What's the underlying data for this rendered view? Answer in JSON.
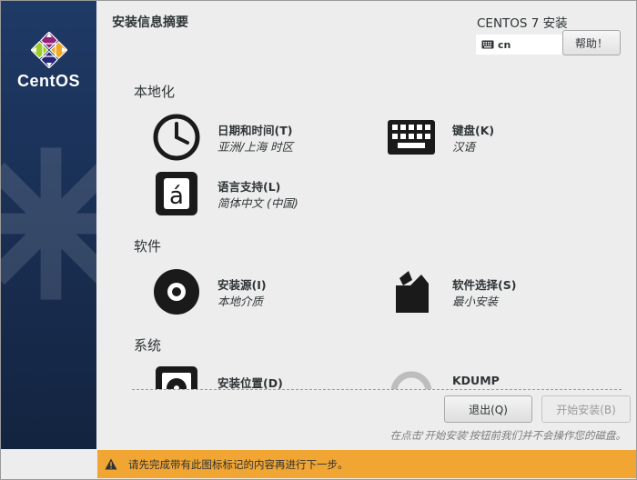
{
  "window": {
    "title": "安装信息摘要",
    "product": "CENTOS 7 安装",
    "brand": "CentOS",
    "keyboard_layout": "cn",
    "help_label": "帮助！"
  },
  "sections": {
    "localization": {
      "heading": "本地化",
      "datetime": {
        "title": "日期和时间(T)",
        "status": "亚洲/上海 时区",
        "icon": "clock-icon"
      },
      "keyboard": {
        "title": "键盘(K)",
        "status": "汉语",
        "icon": "keyboard-icon"
      },
      "language": {
        "title": "语言支持(L)",
        "status": "简体中文 (中国)",
        "icon": "language-icon"
      }
    },
    "software": {
      "heading": "软件",
      "source": {
        "title": "安装源(I)",
        "status": "本地介质",
        "icon": "disc-icon"
      },
      "selection": {
        "title": "软件选择(S)",
        "status": "最小安装",
        "icon": "package-icon"
      }
    },
    "system": {
      "heading": "系统",
      "destination": {
        "title": "安装位置(D)",
        "icon": "harddisk-icon"
      },
      "kdump": {
        "title": "KDUMP",
        "icon": "kdump-icon"
      }
    }
  },
  "footer": {
    "quit_label": "退出(Q)",
    "begin_label": "开始安装(B)",
    "note": "在点击'开始安装'按钮前我们并不会操作您的磁盘。"
  },
  "warning": {
    "text": "请先完成带有此图标标记的内容再进行下一步。",
    "icon": "warning-icon"
  },
  "colors": {
    "sidebar": "#1b3259",
    "background": "#ededed",
    "warning_bar": "#f1a533",
    "icon": "#1a1a1a"
  }
}
